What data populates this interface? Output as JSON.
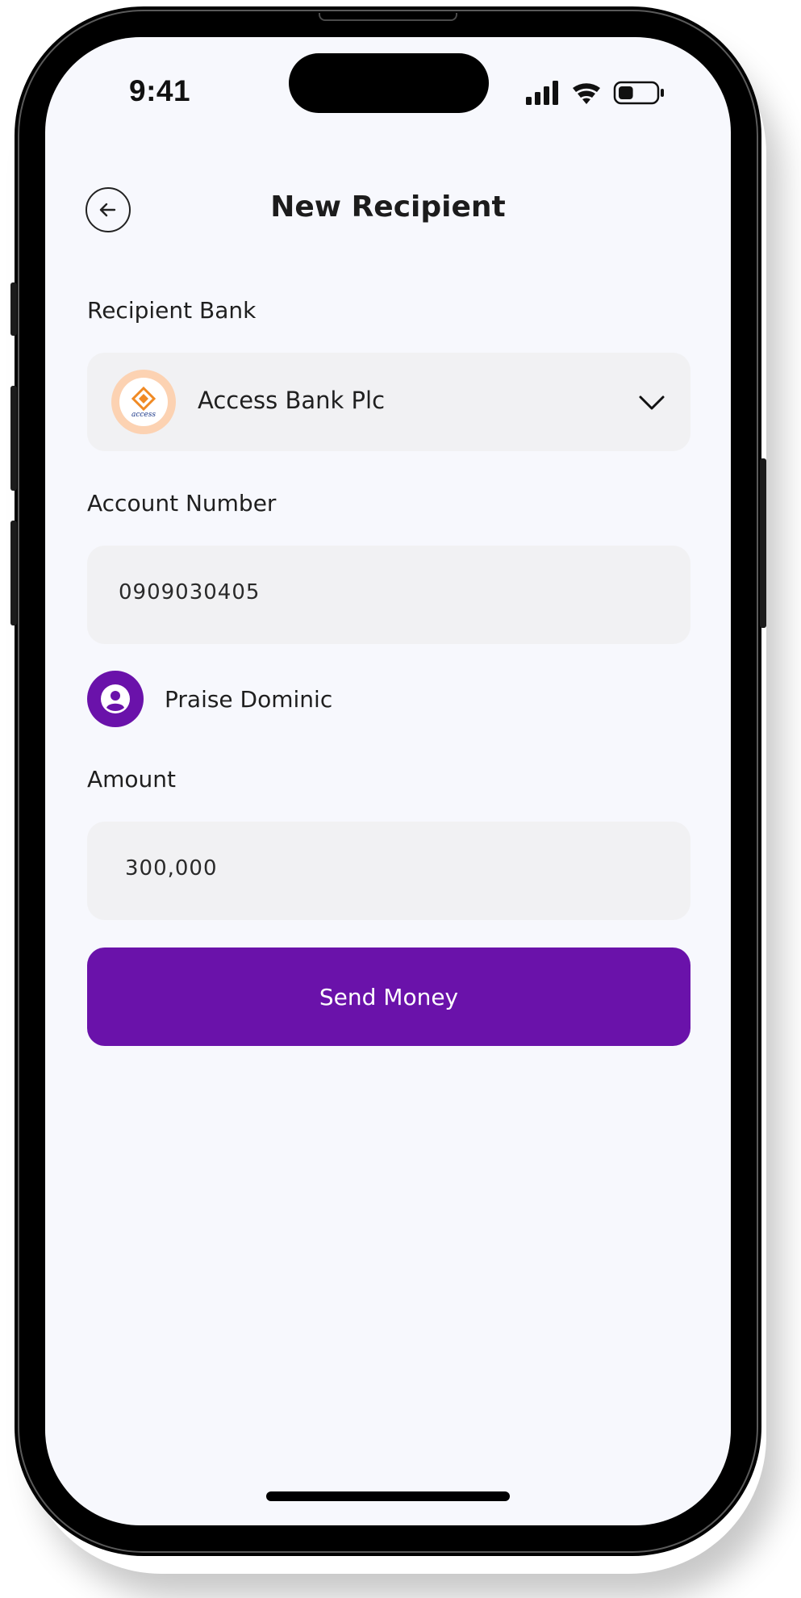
{
  "status_bar": {
    "time": "9:41",
    "icons": [
      "cellular-signal-icon",
      "wifi-icon",
      "battery-icon"
    ],
    "battery_level": 0.4
  },
  "header": {
    "title": "New Recipient",
    "back_icon": "arrow-left-icon"
  },
  "form": {
    "bank": {
      "label": "Recipient Bank",
      "selected": "Access Bank Plc",
      "logo_text": "access",
      "dropdown_icon": "chevron-down-icon"
    },
    "account_number": {
      "label": "Account Number",
      "value": "0909030405"
    },
    "recipient": {
      "name": "Praise Dominic",
      "icon": "user-avatar-icon"
    },
    "amount": {
      "label": "Amount",
      "value": "300,000"
    },
    "submit_label": "Send Money"
  },
  "colors": {
    "primary": "#6a12aa",
    "background": "#f7f8fd",
    "field_background": "#f1f1f3",
    "bank_logo_ring": "#fcd2b2",
    "bank_logo_orange": "#f08a24",
    "bank_logo_navy": "#1e3a8a"
  }
}
